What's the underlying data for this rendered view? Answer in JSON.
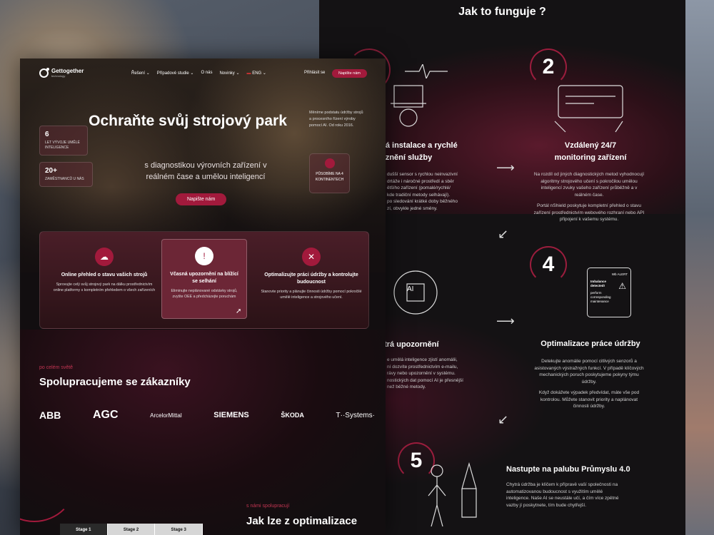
{
  "right": {
    "title": "Jak to funguje ?",
    "step1_head": "chá instalace a rychlé\nvoznění služby",
    "step1_body": "dušší sensor s rychlou neinvazivní\ndrtáže i náročné prostředí a sběr\nětšího zařízení (pomalé/rychlé/\nkde tradiční metody selhávají).\npo sledování krátké doby běžného\nzí, obvykle jedné směny.",
    "step2_num": "2",
    "step2_head": "Vzdálený 24/7\nmonitoring zařízení",
    "step2_p1": "Na rozdíl od jiných diagnostických metod vyhodnocují algoritmy strojového učení s pokročilou umělou inteligencí zvuky vašeho zařízení průběžně a v reálném čase.",
    "step2_p2": "Portál nShield poskytuje kompletní přehled o stavu zařízení prostřednictvím webového rozhraní nebo API připojení k vašemu systému.",
    "step3_head": "ytrá upozornění",
    "step3_body": "e umělá inteligence zjistí anomálii,\nní dozvíte prostřednictvím e-mailu,\nrávy nebo upozornění v systému.\nnostických dat pomocí AI je přesnější\nnež běžné metody.",
    "step4_num": "4",
    "step4_head": "Optimalizace práce údržby",
    "step4_p1": "Detekujte anomálie pomocí citlivých senzorů a asistovaných výstražných funkcí. V případě klíčových mechanických poruch poskytujeme pokyny týmu údržby.",
    "step4_p2": "Když dokážete výpadek předvídat, máte vše pod kontrolou. Můžete stanovit priority a naplánovat činnosti údržby.",
    "step5_num": "5",
    "step5_head": "Nastupte na palubu Průmyslu 4.0",
    "step5_body": "Chytrá údržba je klíčem k přípravě vaší společnosti na automatizovanou budoucnost s využitím umělé inteligence. Naše AI se neustále učí, a čím více zpětné vazby jí poskytnete, tím bude chytřejší.",
    "tablet_alert": "Imbalance detected!",
    "tablet_sub": "perform corresponding maintenance",
    "tablet_tag": "Wb ALERT",
    "chip": "AI"
  },
  "nav": {
    "brand": "Gettogether",
    "brand_sub": "technology",
    "items": [
      "Řešení",
      "Případové studie",
      "O nás",
      "Novinky",
      "ENG"
    ],
    "login": "Přihlásit se",
    "cta": "Napište nám"
  },
  "hero": {
    "title": "Ochraňte svůj strojový park",
    "subtitle": "s diagnostikou výrovních zařízení v reálném čase a umělou inteligencí",
    "cta": "Napište nám",
    "stat1_num": "6",
    "stat1_label": "LET VÝVOJE UMĚLÉ INTELIGENCE",
    "stat2_num": "20+",
    "stat2_label": "ZAMĚSTNANCŮ U NÁS",
    "right_text": "Měníme podstatu údržby strojů a procesního řízení výroby pomocí AI. Od roku 2016.",
    "world": "PŮSOBÍME NA 4 KONTINENTECH"
  },
  "cards": [
    {
      "title": "Online přehled o stavu vašich strojů",
      "body": "Sprovujte celý svůj strojový park na dálku prostřednictvím online platformy s kompletním přehledem o všech zařízeních"
    },
    {
      "title": "Včasná upozornění na blížící se selhání",
      "body": "Eliminujte neplánované odstávky strojů, zvyšte OEE a předcházejte poruchám"
    },
    {
      "title": "Optimalizujte práci údržby a kontrolujte budoucnost",
      "body": "Stanovte priority a plánujte činnosti údržby pomocí pokročilé umělé inteligence a strojového učení."
    }
  ],
  "clients": {
    "kicker": "po celém světě",
    "title": "Spolupracujeme se zákazníky",
    "logos": [
      "ABB",
      "AGC",
      "ArcelorMittal",
      "SIEMENS",
      "ŠKODA",
      "T··Systems·"
    ]
  },
  "bottom": {
    "kicker": "s námi spolupracují",
    "title": "Jak lze z optimalizace",
    "stages": [
      "Stage 1",
      "Stage 2",
      "Stage 3"
    ]
  }
}
